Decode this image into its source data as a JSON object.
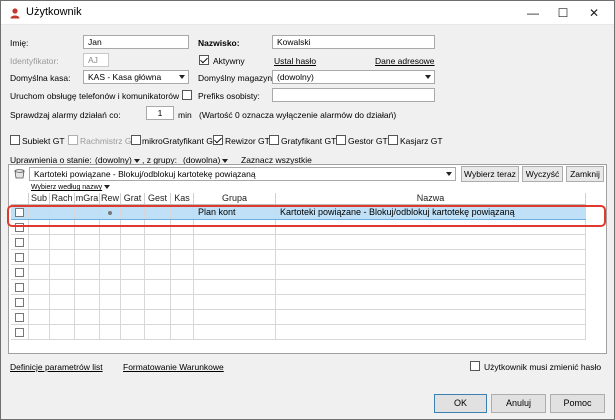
{
  "window": {
    "title": "Użytkownik"
  },
  "titlebar": {
    "minimize": "—",
    "maximize": "☐",
    "close": "✕"
  },
  "form": {
    "imie_label": "Imię:",
    "imie_value": "Jan",
    "nazwisko_label": "Nazwisko:",
    "nazwisko_value": "Kowalski",
    "identyfikator_label": "Identyfikator:",
    "identyfikator_value": "AJ",
    "aktywny_label": "Aktywny",
    "aktywny_checked": true,
    "ustal_haslo": "Ustal hasło",
    "dane_adresowe": "Dane adresowe",
    "kasa_label": "Domyślna kasa:",
    "kasa_value": "KAS - Kasa główna",
    "magazyn_label": "Domyślny magazyn:",
    "magazyn_value": "(dowolny)",
    "telefony_label": "Uruchom obsługę telefonów i komunikatorów",
    "prefiks_label": "Prefiks osobisty:",
    "prefiks_value": "",
    "alarmy_label": "Sprawdzaj alarmy działań co:",
    "alarmy_value": "1",
    "alarmy_unit": "min",
    "alarmy_note": "(Wartość 0 oznacza wyłączenie alarmów do działań)"
  },
  "roles": [
    {
      "label": "Subiekt GT",
      "checked": false,
      "enabled": true
    },
    {
      "label": "Rachmistrz GT",
      "checked": false,
      "enabled": false
    },
    {
      "label": "mikroGratyfikant GT",
      "checked": false,
      "enabled": true
    },
    {
      "label": "Rewizor GT",
      "checked": true,
      "enabled": true
    },
    {
      "label": "Gratyfikant GT",
      "checked": false,
      "enabled": true
    },
    {
      "label": "Gestor GT",
      "checked": false,
      "enabled": true
    },
    {
      "label": "Kasjarz GT",
      "checked": false,
      "enabled": true
    }
  ],
  "filters": {
    "uprawnienia_label": "Uprawnienia o stanie:",
    "stan_value": "(dowolny)",
    "grupy_label": ", z grupy:",
    "grupa_value": "(dowolna)",
    "zaznacz": "Zaznacz wszystkie"
  },
  "panel": {
    "search_value": "Kartoteki powiązane - Blokuj/odblokuj kartotekę powiązaną",
    "wybierz_teraz": "Wybierz teraz",
    "wyczysc": "Wyczyść",
    "zamknij": "Zamknij",
    "wybierz_wedlug": "Wybierz według nazwy"
  },
  "grid": {
    "columns": [
      "",
      "Sub",
      "Rach",
      "mGra",
      "Rew",
      "Grat",
      "Gest",
      "Kas",
      "Grupa",
      "Nazwa"
    ],
    "rows": [
      {
        "selected": true,
        "rew_dot": true,
        "grupa": "Plan kont",
        "nazwa": "Kartoteki powiązane - Blokuj/odblokuj kartotekę powiązaną"
      },
      {
        "selected": false,
        "rew_dot": false,
        "grupa": "",
        "nazwa": ""
      },
      {
        "selected": false,
        "rew_dot": false,
        "grupa": "",
        "nazwa": ""
      },
      {
        "selected": false,
        "rew_dot": false,
        "grupa": "",
        "nazwa": ""
      },
      {
        "selected": false,
        "rew_dot": false,
        "grupa": "",
        "nazwa": ""
      },
      {
        "selected": false,
        "rew_dot": false,
        "grupa": "",
        "nazwa": ""
      },
      {
        "selected": false,
        "rew_dot": false,
        "grupa": "",
        "nazwa": ""
      },
      {
        "selected": false,
        "rew_dot": false,
        "grupa": "",
        "nazwa": ""
      },
      {
        "selected": false,
        "rew_dot": false,
        "grupa": "",
        "nazwa": ""
      }
    ]
  },
  "footer": {
    "definicje": "Definicje parametrów list",
    "formatowanie": "Formatowanie Warunkowe",
    "musi_zmienic": "Użytkownik musi zmienić hasło",
    "ok": "OK",
    "anuluj": "Anuluj",
    "pomoc": "Pomoc"
  },
  "colors": {
    "selection": "#bfe0f7",
    "highlight": "#e03a2f",
    "icon": "#c0392b"
  }
}
